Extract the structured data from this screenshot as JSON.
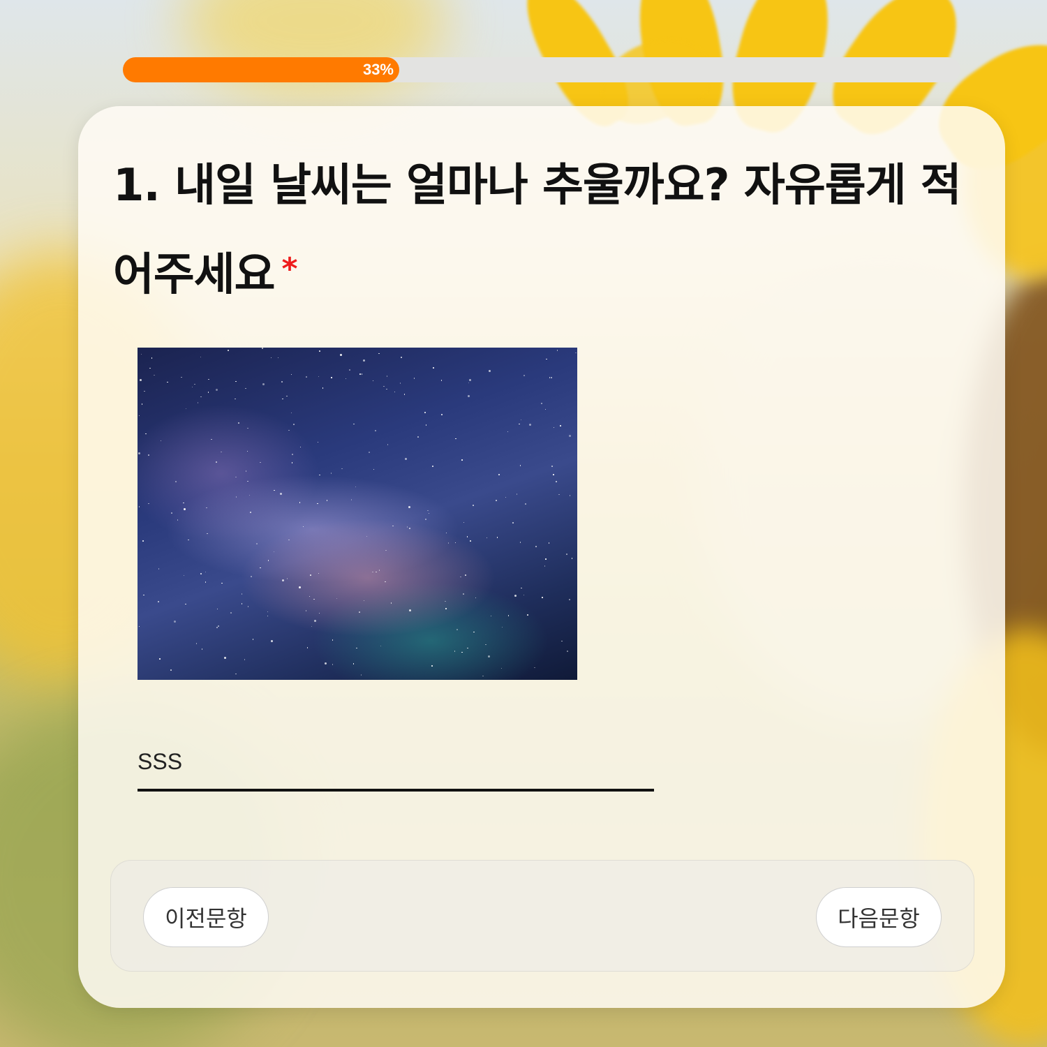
{
  "progress": {
    "value": 0.33,
    "label": "33%",
    "fill_color": "#ff7a00"
  },
  "question": {
    "text": "1. 내일 날씨는 얼마나 추울까요? 자유롭게 적어주세요",
    "required_mark": "*"
  },
  "image": {
    "subject": "starry-night-sky"
  },
  "answer": {
    "value": "SSS"
  },
  "nav": {
    "prev_label": "이전문항",
    "next_label": "다음문항"
  },
  "colors": {
    "accent": "#ff7a00",
    "required": "#ee1c1c"
  }
}
